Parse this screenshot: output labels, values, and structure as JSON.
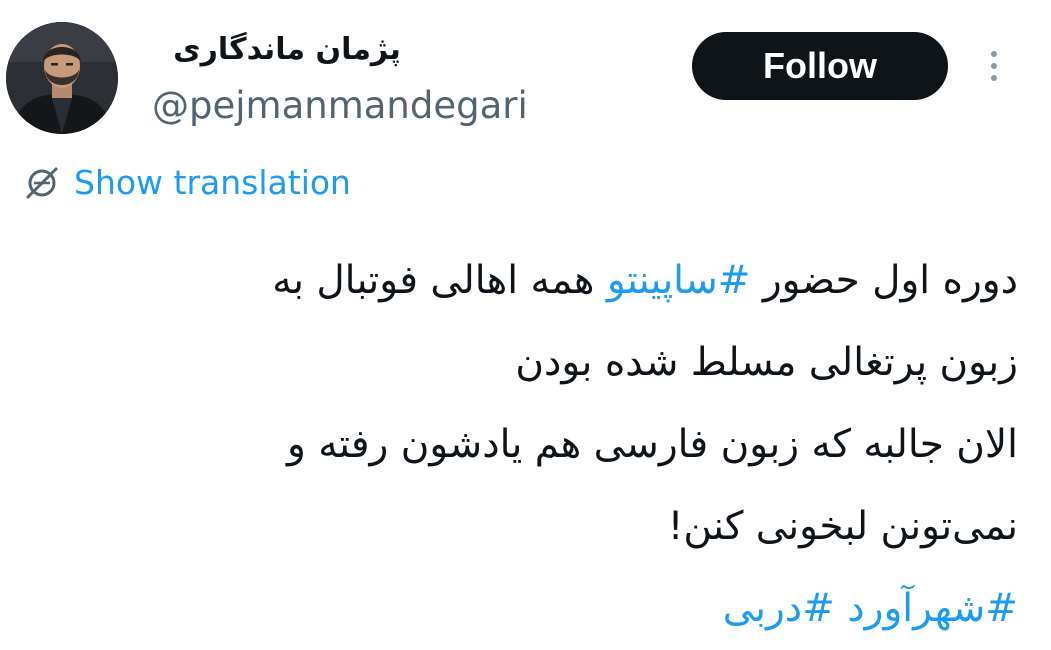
{
  "author": {
    "display_name": "پژمان ماندگاری",
    "handle": "@pejmanmandegari",
    "avatar_icon": "profile-photo"
  },
  "follow_button": {
    "label": "Follow"
  },
  "more_menu": {
    "icon": "vertical-ellipsis-icon"
  },
  "translation": {
    "icon": "globe-slash-icon",
    "label": "Show translation"
  },
  "tweet": {
    "line1_before": "دوره اول حضور ",
    "line1_hashtag": "#ساپینتو",
    "line1_after": " همه اهالی فوتبال به",
    "line2": "زبون پرتغالی مسلط شده بودن",
    "line3": "الان جالبه که زبون فارسی هم یادشون رفته و",
    "line4": "نمی‌تونن لبخونی کنن!",
    "hashtag_a": "#شهرآورد",
    "hashtag_b": "#دربی"
  },
  "colors": {
    "accent": "#1d9bf0",
    "text_primary": "#0f1419",
    "text_secondary": "#536471",
    "button_bg": "#0f1419"
  }
}
